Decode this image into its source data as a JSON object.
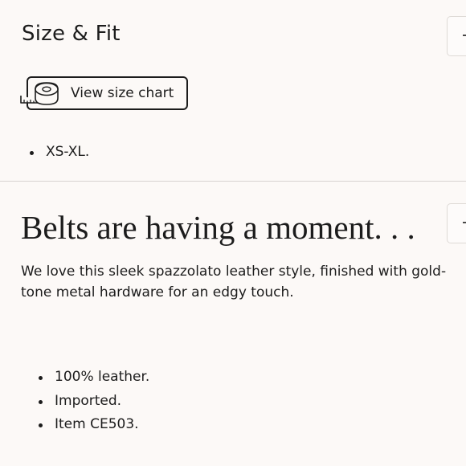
{
  "size_fit": {
    "title": "Size & Fit",
    "size_chart_label": "View size chart",
    "size_chart_icon": "measuring-tape-icon",
    "toggle_icon": "plus-icon",
    "bullets": [
      "XS-XL."
    ]
  },
  "description": {
    "headline": "Belts are having a moment. . .",
    "body": "We love this sleek spazzolato leather style, finished with gold-tone metal hardware for an edgy touch.",
    "toggle_icon": "plus-icon",
    "bullets": [
      "100% leather.",
      "Imported.",
      "Item CE503."
    ]
  },
  "colors": {
    "background": "#fcf9f7",
    "text": "#1c1c1c",
    "divider": "#d7d3d0"
  }
}
